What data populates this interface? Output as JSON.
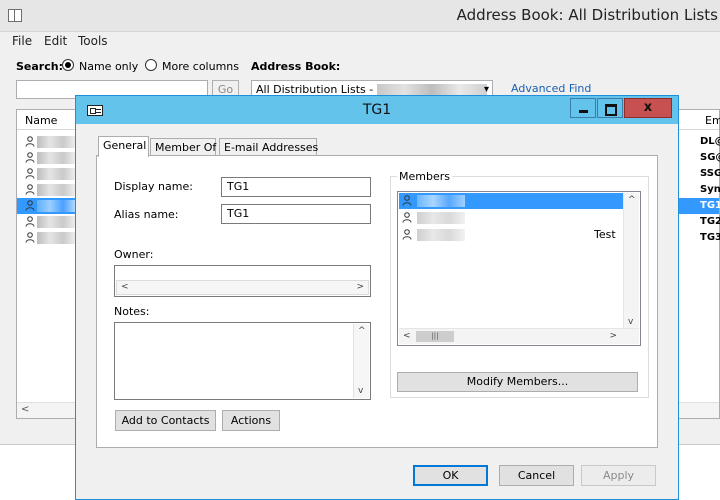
{
  "address_book": {
    "title": "Address Book: All Distribution Lists",
    "menu": [
      "File",
      "Edit",
      "Tools"
    ],
    "search_label": "Search:",
    "radio_name_only": "Name only",
    "radio_more_columns": "More columns",
    "address_book_label": "Address Book:",
    "address_book_value": "All Distribution Lists -",
    "go_label": "Go",
    "advanced_find": "Advanced Find",
    "columns": {
      "name": "Name",
      "email": "Em"
    },
    "rows": [
      {
        "email": "DL@",
        "selected": false
      },
      {
        "email": "SG@",
        "selected": false
      },
      {
        "email": "SSG",
        "selected": false
      },
      {
        "email": "Sync",
        "selected": false
      },
      {
        "email": "TG1",
        "selected": true
      },
      {
        "email": "TG2",
        "selected": false
      },
      {
        "email": "TG3",
        "selected": false
      }
    ]
  },
  "dialog": {
    "title": "TG1",
    "close_label": "x",
    "tabs": [
      "General",
      "Member Of",
      "E-mail Addresses"
    ],
    "display_name_label": "Display name:",
    "display_name_value": "TG1",
    "alias_name_label": "Alias name:",
    "alias_name_value": "TG1",
    "owner_label": "Owner:",
    "notes_label": "Notes:",
    "members_label": "Members",
    "members": [
      {
        "text": "",
        "selected": true
      },
      {
        "text": "",
        "selected": false
      },
      {
        "text": "Test",
        "selected": false
      }
    ],
    "modify_members": "Modify Members...",
    "add_to_contacts": "Add to Contacts",
    "actions": "Actions",
    "ok": "OK",
    "cancel": "Cancel",
    "apply": "Apply"
  },
  "colors": {
    "titlebar": "#63c3ea",
    "selection": "#3399ff",
    "close": "#c75050",
    "link": "#1a5fb4"
  }
}
